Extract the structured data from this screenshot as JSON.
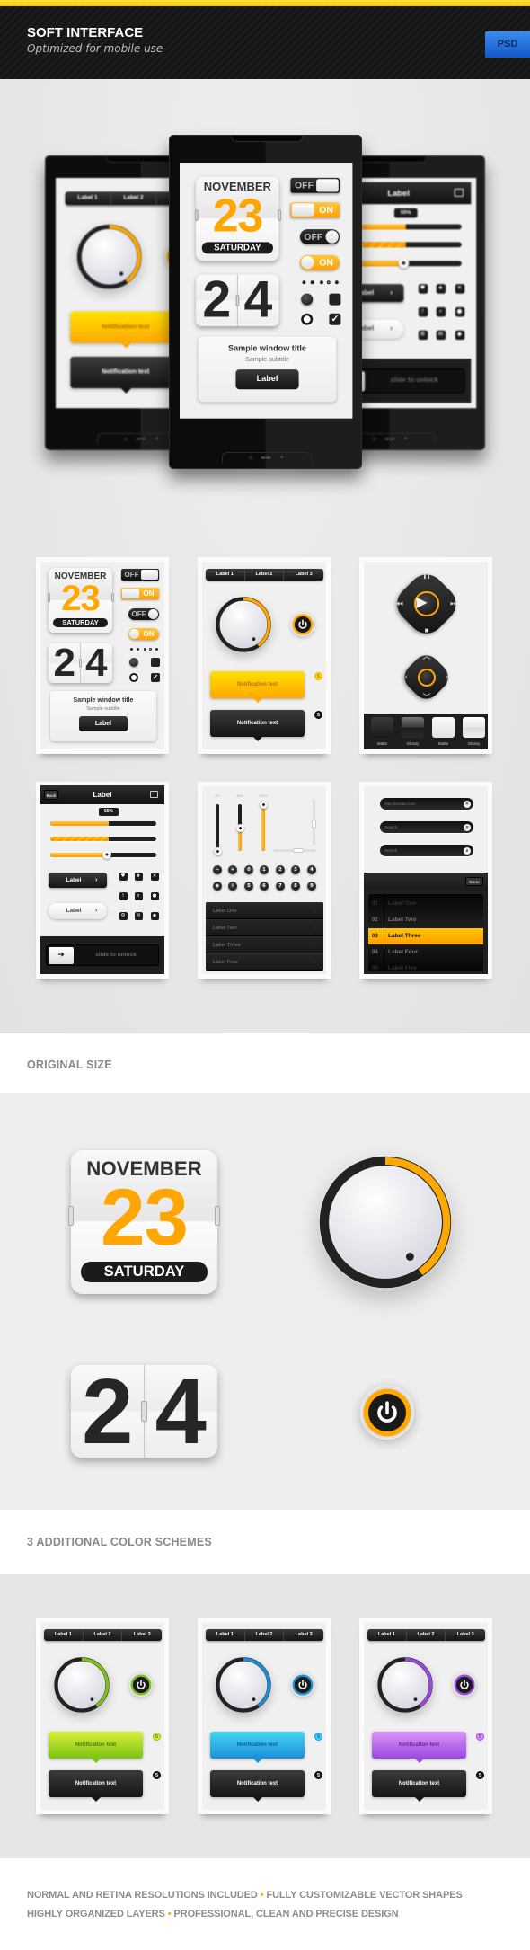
{
  "header": {
    "title": "SOFT INTERFACE",
    "subtitle": "Optimized for mobile use",
    "badge": "PSD"
  },
  "calendar": {
    "month": "NOVEMBER",
    "day": "23",
    "weekday": "SATURDAY"
  },
  "flip": {
    "digit1": "2",
    "digit2": "4"
  },
  "toggles": [
    {
      "label": "OFF",
      "on": false
    },
    {
      "label": "ON",
      "on": true
    },
    {
      "label": "OFF",
      "on": false
    },
    {
      "label": "ON",
      "on": true
    }
  ],
  "window": {
    "title": "Sample window title",
    "subtitle": "Sample subtitle",
    "button": "Label"
  },
  "tabs": [
    "Label 1",
    "Label 2",
    "Label 3"
  ],
  "notification": {
    "text": "Notification text",
    "badge": "5"
  },
  "swatches": [
    "Matte",
    "Glossy",
    "Matte",
    "Glossy"
  ],
  "navbar": {
    "back": "Back",
    "title": "Label"
  },
  "progress": {
    "value": 55,
    "label": "55%"
  },
  "buttons": {
    "dark": "Label",
    "light": "Label"
  },
  "unlock": "slide to unlock",
  "vsliders": {
    "labels": [
      "0%",
      "50%",
      "100%"
    ],
    "values": [
      0,
      50,
      100
    ]
  },
  "numpad": {
    "row1": [
      "minus-icon",
      "plus-icon",
      "0",
      "1",
      "2",
      "3",
      "4"
    ],
    "row2": [
      "record-icon",
      "info-icon",
      "5",
      "6",
      "7",
      "8",
      "9"
    ]
  },
  "icon_grid": [
    "heart-icon",
    "star-icon",
    "close-icon",
    "alert-icon",
    "search-icon",
    "location-icon",
    "gear-icon",
    "mail-icon",
    "diamond-icon"
  ],
  "list": [
    "Label One",
    "Label Two",
    "Label Three",
    "Label Four"
  ],
  "fields": {
    "url": "http://envato.com",
    "search": "Search"
  },
  "picker": {
    "done": "Done",
    "selected": 2,
    "rows": [
      {
        "num": "01",
        "label": "Label One"
      },
      {
        "num": "02",
        "label": "Label Two"
      },
      {
        "num": "03",
        "label": "Label Three"
      },
      {
        "num": "04",
        "label": "Label Four"
      },
      {
        "num": "05",
        "label": "Label Five"
      }
    ]
  },
  "sections": {
    "original": "ORIGINAL SIZE",
    "schemes": "3 ADDITIONAL COLOR SCHEMES"
  },
  "footer": {
    "line1": [
      "NORMAL AND RETINA RESOLUTIONS INCLUDED",
      "FULLY CUSTOMIZABLE VECTOR SHAPES"
    ],
    "line2": [
      "HIGHLY ORGANIZED LAYERS",
      "PROFESSIONAL, CLEAN AND PRECISE DESIGN"
    ],
    "separator": "•"
  },
  "colors": {
    "brand_yellow": "#ffd200",
    "psd_blue": "#1e6fd8",
    "dark": "#1c1c1c",
    "schemes": [
      {
        "accent": "#ffa800",
        "light": "#ffe000",
        "text": "#b56f00"
      },
      {
        "accent": "#7cc414",
        "light": "#d6ee3c",
        "text": "#4c7a00"
      },
      {
        "accent": "#1a8fd8",
        "light": "#44d6f0",
        "text": "#0d5c94"
      },
      {
        "accent": "#9a48e0",
        "light": "#d994f8",
        "text": "#6a22a8"
      }
    ]
  }
}
